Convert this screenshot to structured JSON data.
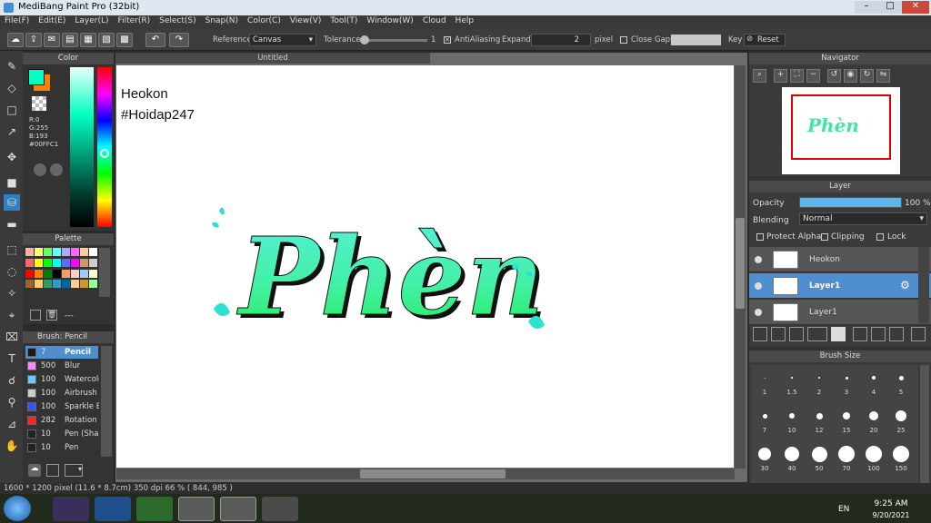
{
  "window": {
    "title": "MediBang Paint Pro (32bit)"
  },
  "menu": [
    "File(F)",
    "Edit(E)",
    "Layer(L)",
    "Filter(R)",
    "Select(S)",
    "Snap(N)",
    "Color(C)",
    "View(V)",
    "Tool(T)",
    "Window(W)",
    "Cloud",
    "Help"
  ],
  "toolbar": {
    "reference_label": "Reference",
    "reference_value": "Canvas",
    "tolerance_label": "Tolerance",
    "tolerance_value": "1",
    "antialias_label": "AntiAliasing",
    "expand_label": "Expand",
    "expand_value": "2",
    "expand_unit": "pixel",
    "close_gaps_label": "Close Gaps",
    "key_label": "Key",
    "reset_label": "Reset"
  },
  "color_panel": {
    "title": "Color",
    "r": "R:0",
    "g": "G:255",
    "b": "B:193",
    "hex": "#00FFC1",
    "fg": "#00FFC1",
    "bg": "#FF8000"
  },
  "palette_panel": {
    "title": "Palette",
    "empty_label": "---",
    "swatches": [
      "#ffb0a0",
      "#ffff66",
      "#66ff66",
      "#66ffff",
      "#aaaaff",
      "#ff66ff",
      "#ffcc99",
      "#ffffff",
      "#ff6666",
      "#ffff00",
      "#00ff00",
      "#00ffff",
      "#6666ff",
      "#ff00ff",
      "#cc9966",
      "#cccccc",
      "#ff0000",
      "#ff8000",
      "#008000",
      "#000000",
      "#ff9966",
      "#ffcccc",
      "#99ccff",
      "#ffffcc",
      "#996633",
      "#ffcc66",
      "#339966",
      "#3399cc",
      "#006699",
      "#ffcc99",
      "#cc9933",
      "#99ff99"
    ]
  },
  "brush_panel": {
    "title": "Brush: Pencil",
    "items": [
      {
        "size": "7",
        "name": "Pencil",
        "color": "#1a1a1a",
        "active": true
      },
      {
        "size": "500",
        "name": "Blur",
        "color": "#ff88ff"
      },
      {
        "size": "100",
        "name": "Watercolor",
        "color": "#66ccff"
      },
      {
        "size": "100",
        "name": "Airbrush",
        "color": "#cccccc"
      },
      {
        "size": "100",
        "name": "Sparkle Brush",
        "color": "#3355ff"
      },
      {
        "size": "282",
        "name": "Rotation Symmetry",
        "color": "#ff2222"
      },
      {
        "size": "10",
        "name": "Pen (Sharp)",
        "color": "#222222"
      },
      {
        "size": "10",
        "name": "Pen",
        "color": "#222222"
      }
    ]
  },
  "canvas": {
    "tab_title": "Untitled",
    "text_line1": "Heokon",
    "text_line2": "#Hoidap247",
    "art_word": "Phèn"
  },
  "navigator": {
    "title": "Navigator"
  },
  "layer_panel": {
    "title": "Layer",
    "opacity_label": "Opacity",
    "opacity_value": "100 %",
    "opacity_fraction": 1.0,
    "blending_label": "Blending",
    "blending_value": "Normal",
    "protect_alpha_label": "Protect Alpha",
    "clipping_label": "Clipping",
    "lock_label": "Lock",
    "layers": [
      {
        "name": "Heokon",
        "active": false
      },
      {
        "name": "Layer1",
        "active": true
      },
      {
        "name": "Layer1",
        "active": false
      }
    ]
  },
  "brush_size_panel": {
    "title": "Brush Size",
    "sizes": [
      "1",
      "1.5",
      "2",
      "3",
      "4",
      "5",
      "7",
      "10",
      "12",
      "15",
      "20",
      "25",
      "30",
      "40",
      "50",
      "70",
      "100",
      "150"
    ]
  },
  "statusbar": {
    "text": "1600 * 1200 pixel  (11.6 * 8.7cm)  350 dpi  66 %  ( 844, 985 )"
  },
  "taskbar": {
    "lang": "EN",
    "time": "9:25 AM",
    "date": "9/20/2021"
  }
}
